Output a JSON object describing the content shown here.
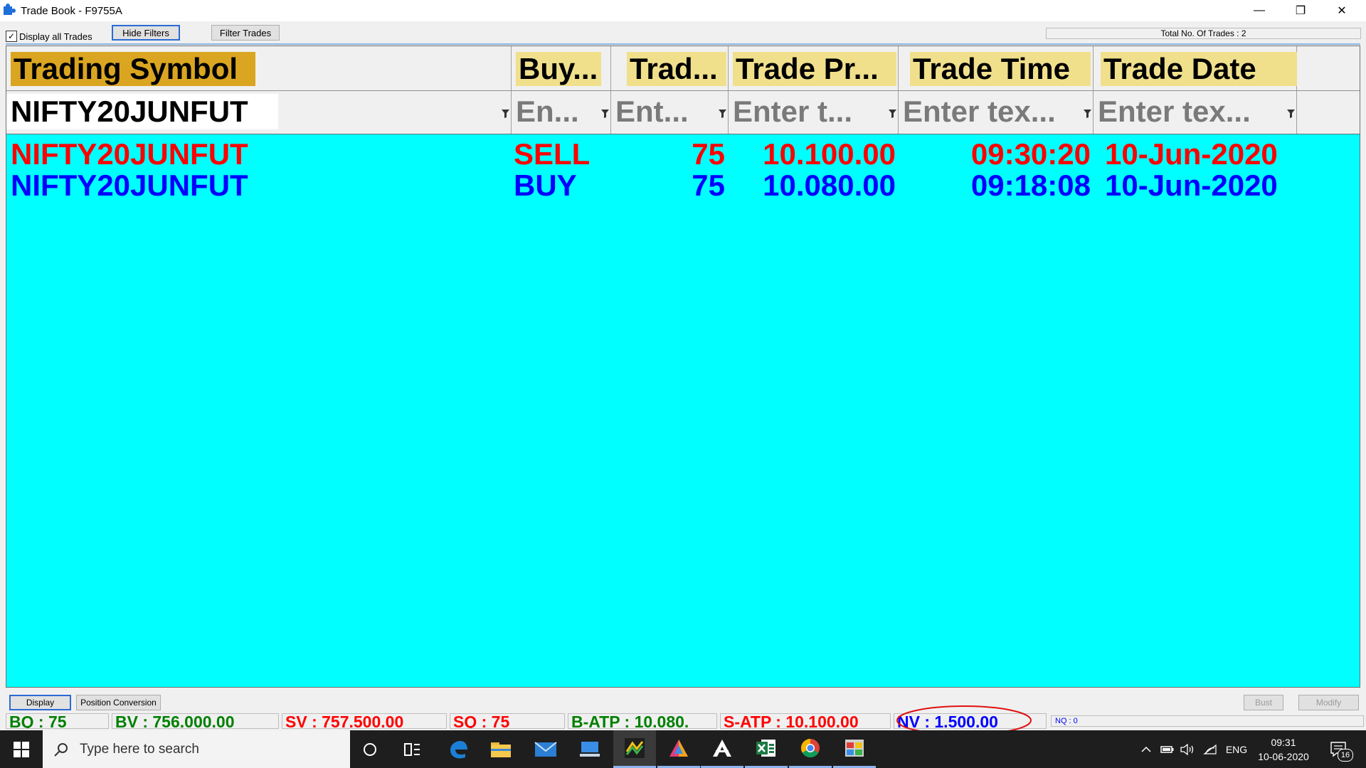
{
  "window": {
    "title": "Trade Book - F9755A",
    "minimize_glyph": "—",
    "restore_glyph": "❐",
    "close_glyph": "✕"
  },
  "toolbar": {
    "display_all_label": "Display all Trades",
    "display_all_checked": true,
    "hide_filters_label": "Hide Filters",
    "filter_trades_label": "Filter Trades",
    "total_trades_text": "Total No. Of Trades : 2"
  },
  "grid": {
    "columns": [
      {
        "header": "Trading Symbol",
        "filter_value": "NIFTY20JUNFUT",
        "filter_placeholder": ""
      },
      {
        "header": "Buy...",
        "filter_value": "",
        "filter_placeholder": "En..."
      },
      {
        "header": "Trad...",
        "filter_value": "",
        "filter_placeholder": "Ent..."
      },
      {
        "header": "Trade Pr...",
        "filter_value": "",
        "filter_placeholder": "Enter t..."
      },
      {
        "header": "Trade Time",
        "filter_value": "",
        "filter_placeholder": "Enter tex..."
      },
      {
        "header": "Trade Date",
        "filter_value": "",
        "filter_placeholder": "Enter tex..."
      }
    ],
    "rows": [
      {
        "symbol": "NIFTY20JUNFUT",
        "side": "SELL",
        "qty": "75",
        "price": "10.100.00",
        "time": "09:30:20",
        "date": "10-Jun-2020",
        "color": "#ff0000"
      },
      {
        "symbol": "NIFTY20JUNFUT",
        "side": "BUY",
        "qty": "75",
        "price": "10.080.00",
        "time": "09:18:08",
        "date": "10-Jun-2020",
        "color": "#0000ff"
      }
    ],
    "colors": {
      "background": "#00ffff",
      "header_primary": "#daa520",
      "header_secondary": "#f0e08c"
    }
  },
  "bottom": {
    "display_label": "Display",
    "position_conversion_label": "Position Conversion",
    "bust_label": "Bust",
    "modify_label": "Modify"
  },
  "stats": {
    "bq": "BQ : 75",
    "bv": "BV : 756.000.00",
    "sv": "SV : 757.500.00",
    "sq": "SQ : 75",
    "batp": "B-ATP : 10.080.",
    "satp": "S-ATP : 10.100.00",
    "nv": "NV : 1.500.00",
    "nq": "NQ : 0"
  },
  "taskbar": {
    "search_placeholder": "Type here to search",
    "apps": [
      "cortana-icon",
      "task-view-icon",
      "edge-icon",
      "file-explorer-icon",
      "mail-icon",
      "remote-desktop-icon",
      "trading-terminal-icon",
      "prism-icon",
      "aquila-icon",
      "excel-icon",
      "chrome-icon",
      "window-app-icon"
    ],
    "language": "ENG",
    "time": "09:31",
    "date": "10-06-2020",
    "notifications": "16"
  }
}
